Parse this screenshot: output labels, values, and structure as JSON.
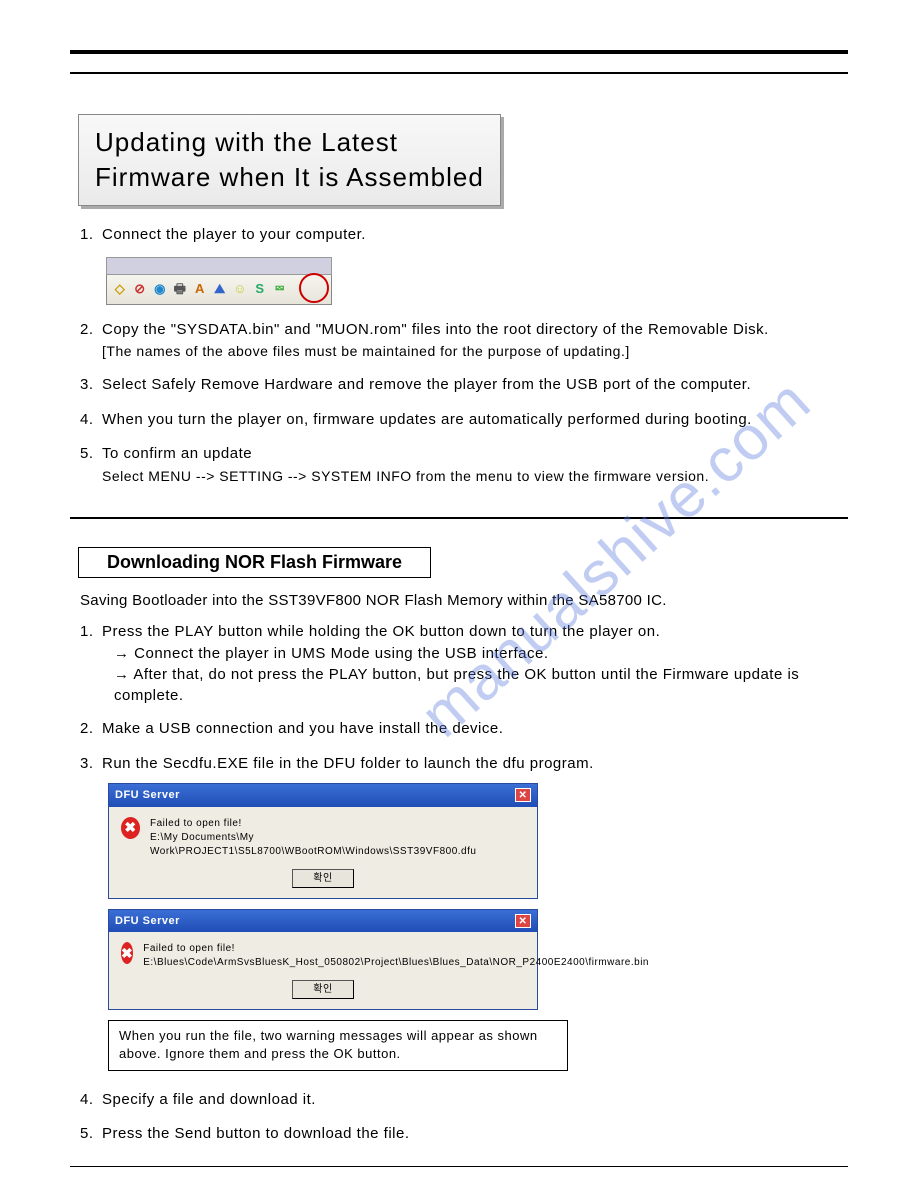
{
  "watermark": "manualshive.com",
  "section1": {
    "title_line1": "Updating with the Latest",
    "title_line2": "Firmware when It is Assembled",
    "steps": {
      "s1": {
        "num": "1.",
        "text": "Connect the player to your computer."
      },
      "s2": {
        "num": "2.",
        "text": "Copy the \"SYSDATA.bin\" and \"MUON.rom\" files into the root directory of the Removable Disk.",
        "sub": "[The names of the above files must be maintained for the purpose of updating.]"
      },
      "s3": {
        "num": "3.",
        "text": "Select Safely Remove Hardware and remove the player from the USB port of the computer."
      },
      "s4": {
        "num": "4.",
        "text": "When you turn the player on, firmware updates are automatically performed during booting."
      },
      "s5": {
        "num": "5.",
        "text": "To confirm an update",
        "sub": "Select MENU --> SETTING --> SYSTEM INFO from the menu to view the firmware version."
      }
    }
  },
  "section2": {
    "heading": "Downloading NOR Flash  Firmware",
    "intro": "Saving Bootloader into the SST39VF800 NOR Flash Memory within the SA58700 IC.",
    "steps": {
      "s1": {
        "num": "1.",
        "text": "Press the PLAY button while holding the OK button down to turn the player on.",
        "arrow1": "→ Connect the player in UMS Mode using the USB interface.",
        "arrow2": "→ After that, do not press the PLAY button, but press the OK button until the Firmware update is complete."
      },
      "s2": {
        "num": "2.",
        "text": "Make a USB connection and you have install the device."
      },
      "s3": {
        "num": "3.",
        "text": "Run the Secdfu.EXE file in the DFU folder to launch the dfu program."
      },
      "s4": {
        "num": "4.",
        "text": "Specify a file and download it."
      },
      "s5": {
        "num": "5.",
        "text": "Press the Send button to download the file."
      }
    },
    "dialog1": {
      "title": "DFU Server",
      "err_label": "Failed to open file!",
      "err_path": "E:\\My Documents\\My Work\\PROJECT1\\S5L8700\\WBootROM\\Windows\\SST39VF800.dfu",
      "ok": "확인"
    },
    "dialog2": {
      "title": "DFU Server",
      "err_label": "Failed to open file!",
      "err_path": "E:\\Blues\\Code\\ArmSvsBluesK_Host_050802\\Project\\Blues\\Blues_Data\\NOR_P2400E2400\\firmware.bin",
      "ok": "확인"
    },
    "note": "When you run the file, two warning messages will appear as shown above. Ignore them and press the OK button."
  }
}
